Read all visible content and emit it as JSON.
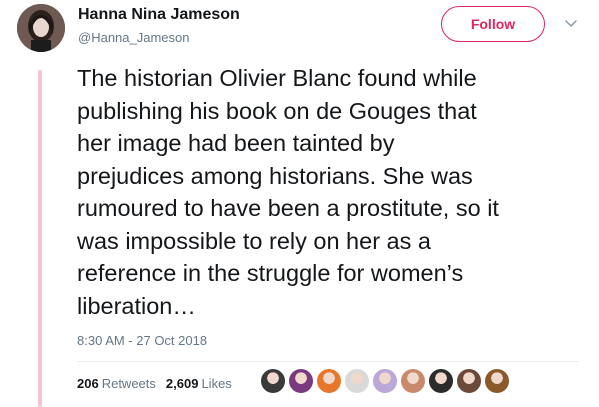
{
  "author": {
    "name": "Hanna Nina Jameson",
    "handle": "@Hanna_Jameson",
    "avatar_icon": "profile-photo"
  },
  "follow_button": {
    "label": "Follow",
    "color": "#e0245e"
  },
  "menu_icon": "chevron-down-icon",
  "tweet": {
    "text": "The historian Olivier Blanc found while\npublishing his book on de Gouges that\nher image had been tainted by\nprejudices among historians. She was\nrumoured to have been a prostitute, so it\nwas impossible to rely on her as a\nreference in the struggle for women’s\nliberation…",
    "timestamp": "8:30 AM - 27 Oct 2018"
  },
  "stats": {
    "retweets_count": "206",
    "retweets_label": "Retweets",
    "likes_count": "2,609",
    "likes_label": "Likes"
  },
  "thread_line_color": "#f4c4d3",
  "liker_avatars": [
    {
      "name": "liker-avatar-1",
      "color": "#3a3a3a"
    },
    {
      "name": "liker-avatar-2",
      "color": "#7a3b7e"
    },
    {
      "name": "liker-avatar-3",
      "color": "#e8762b"
    },
    {
      "name": "liker-avatar-4",
      "color": "#d9d9d9"
    },
    {
      "name": "liker-avatar-5",
      "color": "#b9a8d8"
    },
    {
      "name": "liker-avatar-6",
      "color": "#c98a6c"
    },
    {
      "name": "liker-avatar-7",
      "color": "#2b2b2b"
    },
    {
      "name": "liker-avatar-8",
      "color": "#6b4a3a"
    },
    {
      "name": "liker-avatar-9",
      "color": "#8a5a2b"
    }
  ]
}
